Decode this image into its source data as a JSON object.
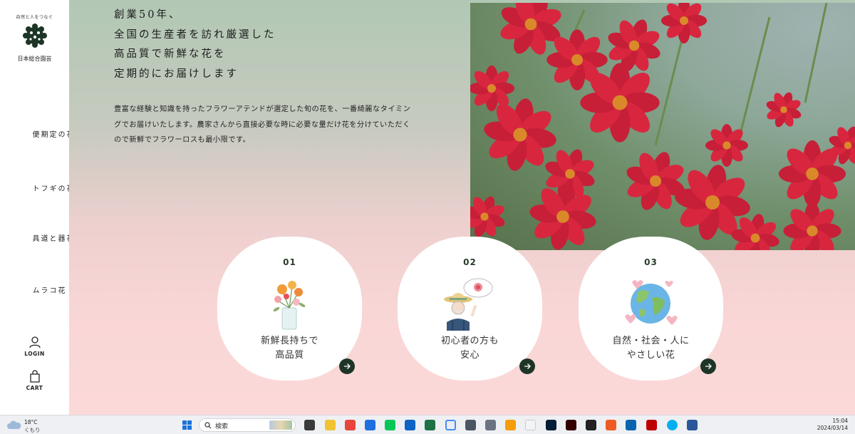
{
  "sidebar": {
    "tagline": "自然と人をつなぐ",
    "brand": "日本総合園芸",
    "nav": [
      {
        "label": "花の定期便"
      },
      {
        "label": "花のギフト"
      },
      {
        "label": "花器と道具"
      },
      {
        "label": "花コラム"
      }
    ],
    "login_label": "LOGIN",
    "cart_label": "CART"
  },
  "hero": {
    "headline": [
      "創業50年、",
      "全国の生産者を訪れ厳選した",
      "高品質で新鮮な花を",
      "定期的にお届けします"
    ],
    "body": "豊富な経験と知識を持ったフラワーアテンドが選定した旬の花を、一番綺麗なタイミングでお届けいたします。農家さんから直接必要な時に必要な量だけ花を分けていただくので新鮮でフラワーロスも最小限です。"
  },
  "features": [
    {
      "num": "01",
      "line1": "新鮮長持ちで",
      "line2": "高品質",
      "icon": "flower-vase-illustration"
    },
    {
      "num": "02",
      "line1": "初心者の方も",
      "line2": "安心",
      "icon": "farmer-illustration"
    },
    {
      "num": "03",
      "line1": "自然・社会・人に",
      "line2": "やさしい花",
      "icon": "earth-illustration"
    }
  ],
  "colors": {
    "accent_dark_green": "#1d3527",
    "flower_red": "#d9263f",
    "bg_top": "#b1c8b4",
    "bg_bottom": "#fcd9d9"
  },
  "taskbar": {
    "temp": "18°C",
    "condition": "くもり",
    "search_placeholder": "検索",
    "time": "15:04",
    "date": "2024/03/14"
  }
}
